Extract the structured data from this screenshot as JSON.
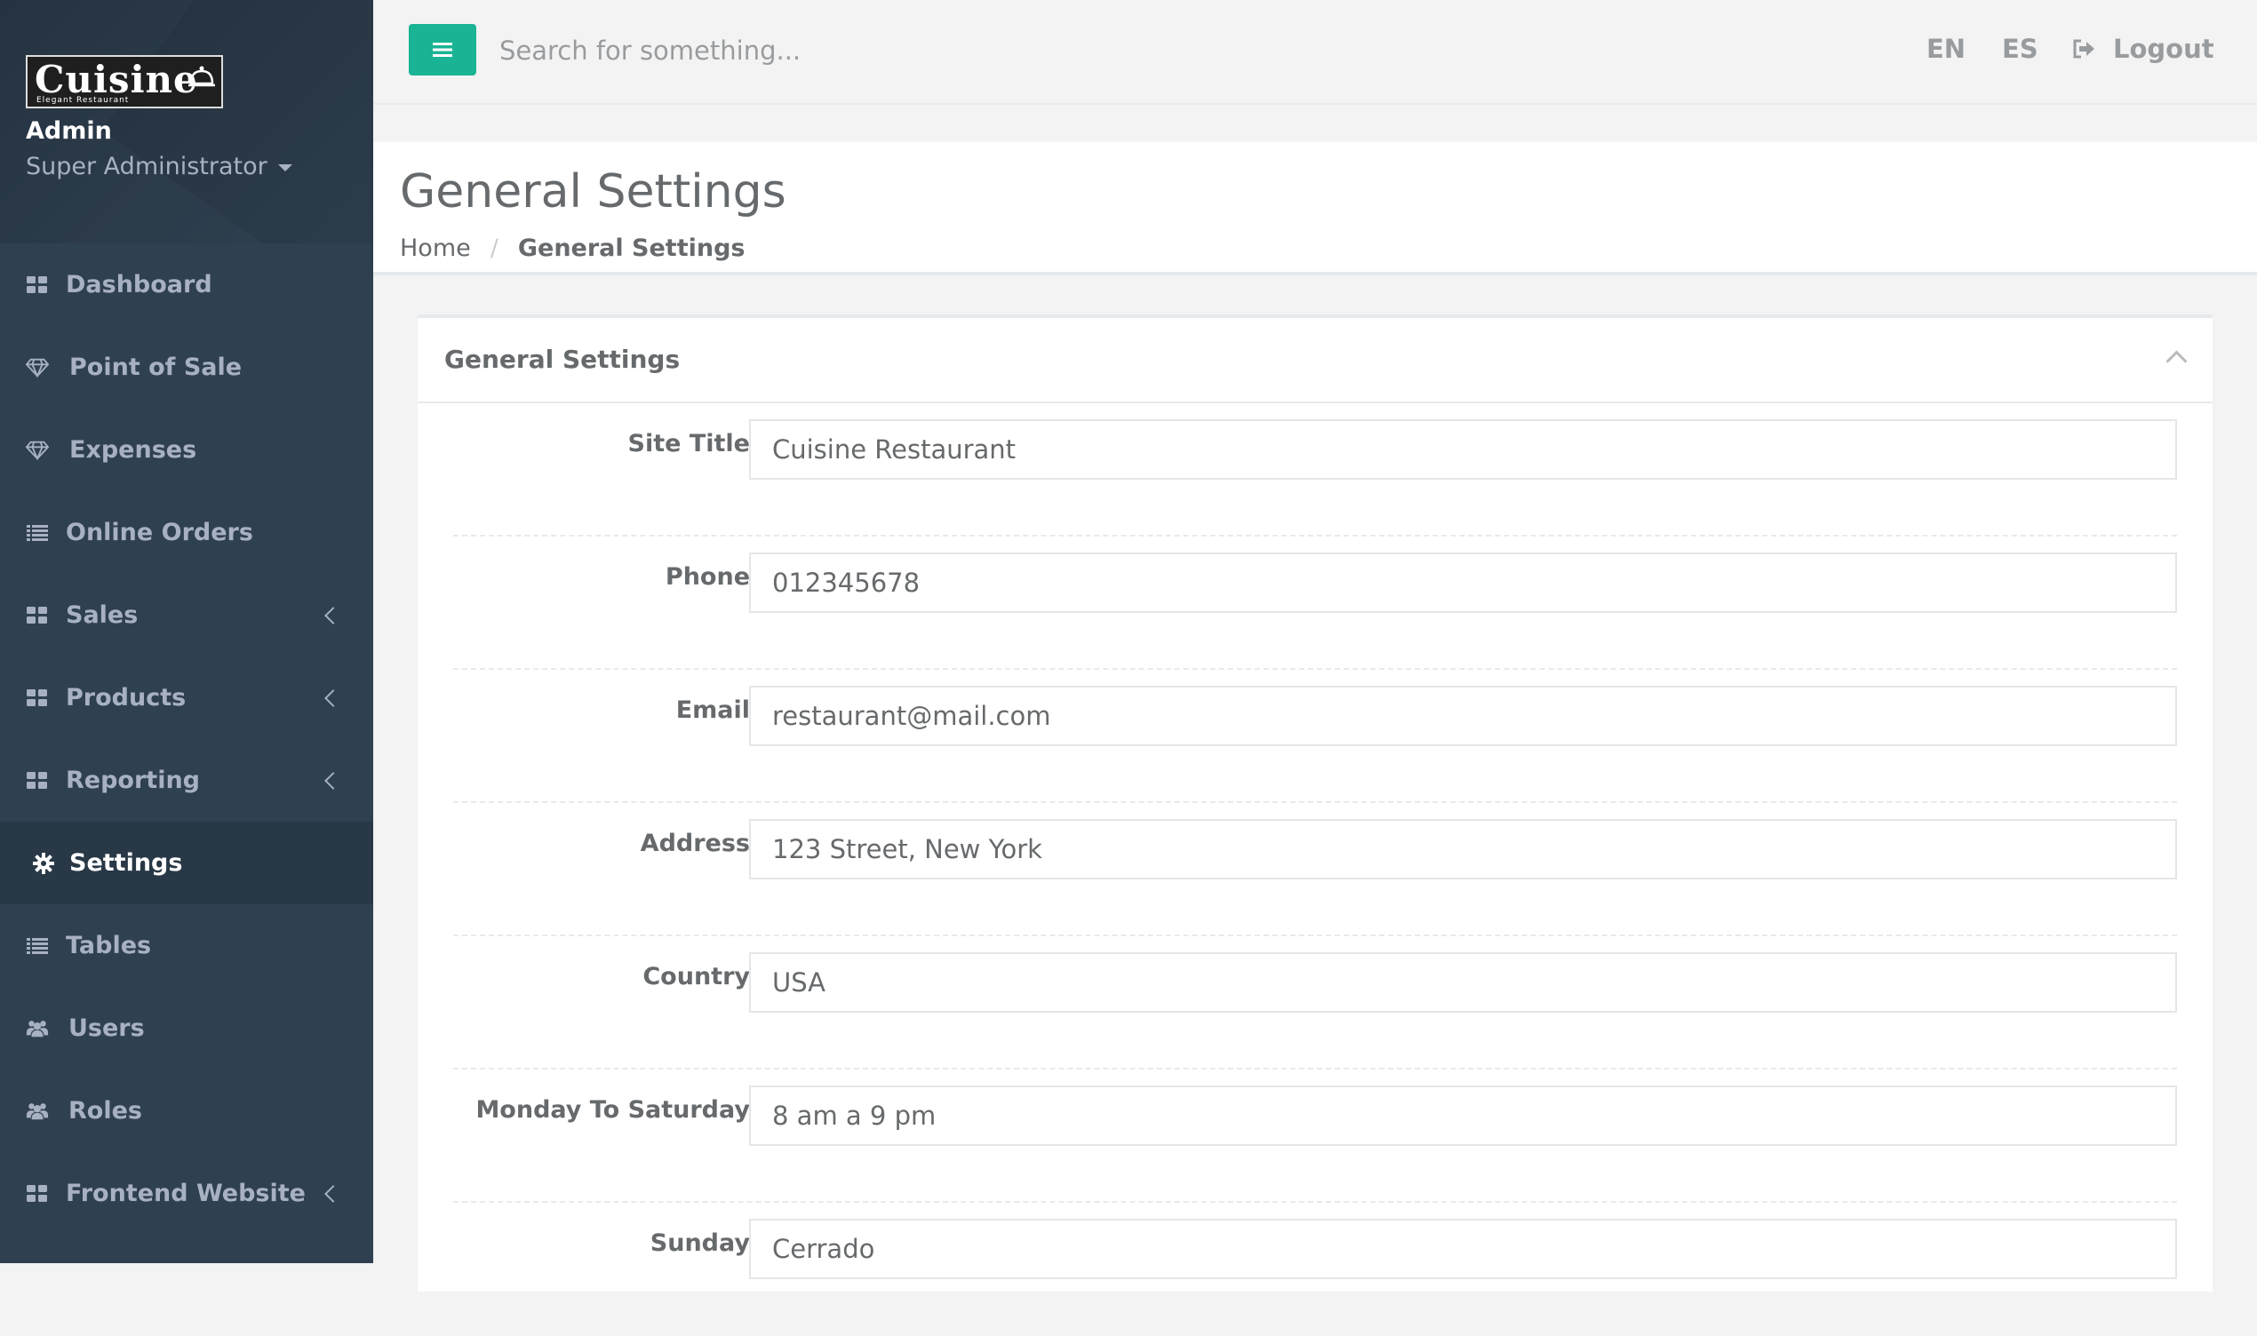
{
  "sidebar": {
    "logo": {
      "brand": "Cuisine",
      "tagline": "Elegant Restaurant"
    },
    "profile": {
      "name": "Admin",
      "role": "Super Administrator"
    },
    "items": [
      {
        "label": "Dashboard",
        "icon": "grid-icon",
        "has_submenu": false,
        "active": false
      },
      {
        "label": "Point of Sale",
        "icon": "diamond-icon",
        "has_submenu": false,
        "active": false
      },
      {
        "label": "Expenses",
        "icon": "diamond-icon",
        "has_submenu": false,
        "active": false
      },
      {
        "label": "Online Orders",
        "icon": "list-icon",
        "has_submenu": false,
        "active": false
      },
      {
        "label": "Sales",
        "icon": "grid-icon",
        "has_submenu": true,
        "active": false
      },
      {
        "label": "Products",
        "icon": "grid-icon",
        "has_submenu": true,
        "active": false
      },
      {
        "label": "Reporting",
        "icon": "grid-icon",
        "has_submenu": true,
        "active": false
      },
      {
        "label": "Settings",
        "icon": "gear-icon",
        "has_submenu": false,
        "active": true
      },
      {
        "label": "Tables",
        "icon": "list-icon",
        "has_submenu": false,
        "active": false
      },
      {
        "label": "Users",
        "icon": "users-icon",
        "has_submenu": false,
        "active": false
      },
      {
        "label": "Roles",
        "icon": "users-icon",
        "has_submenu": false,
        "active": false
      },
      {
        "label": "Frontend Website",
        "icon": "grid-icon",
        "has_submenu": true,
        "active": false
      }
    ]
  },
  "topbar": {
    "search_placeholder": "Search for something...",
    "lang_en": "EN",
    "lang_es": "ES",
    "logout_label": "Logout"
  },
  "page": {
    "title": "General Settings",
    "breadcrumb": {
      "home": "Home",
      "current": "General Settings"
    }
  },
  "panel": {
    "title": "General Settings",
    "fields": [
      {
        "label": "Site Title",
        "value": "Cuisine Restaurant"
      },
      {
        "label": "Phone",
        "value": "012345678"
      },
      {
        "label": "Email",
        "value": "restaurant@mail.com"
      },
      {
        "label": "Address",
        "value": "123 Street, New York"
      },
      {
        "label": "Country",
        "value": "USA"
      },
      {
        "label": "Monday To Saturday",
        "value": "8 am a 9 pm"
      },
      {
        "label": "Sunday",
        "value": "Cerrado"
      }
    ]
  },
  "colors": {
    "sidebar": "#2f4050",
    "accent": "#1ab394",
    "active_item": "#293846"
  }
}
